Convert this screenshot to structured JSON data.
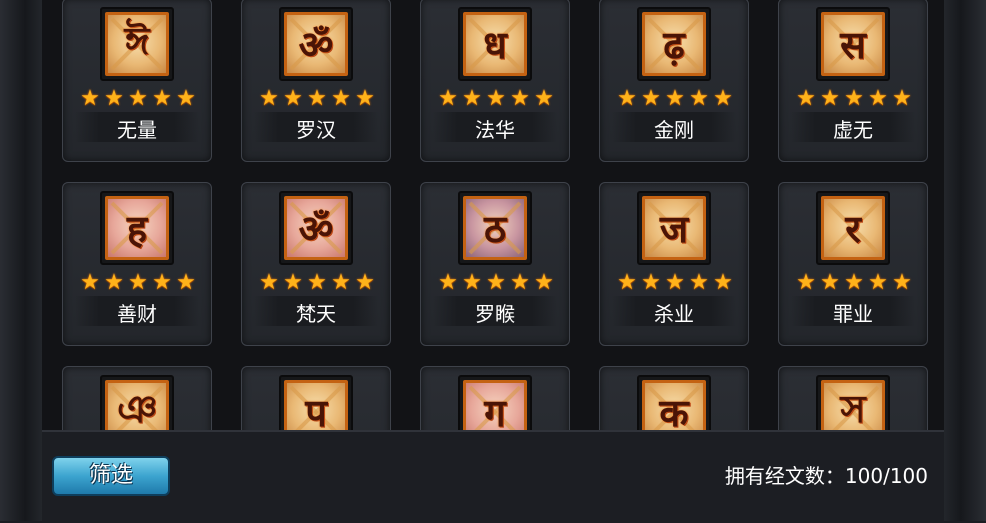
{
  "cards": [
    {
      "name": "无量",
      "stars": 5,
      "glyph": "ঈ",
      "tone": "gold"
    },
    {
      "name": "罗汉",
      "stars": 5,
      "glyph": "ॐ",
      "tone": "gold"
    },
    {
      "name": "法华",
      "stars": 5,
      "glyph": "ध",
      "tone": "gold"
    },
    {
      "name": "金刚",
      "stars": 5,
      "glyph": "ढ़",
      "tone": "gold"
    },
    {
      "name": "虚无",
      "stars": 5,
      "glyph": "स",
      "tone": "gold"
    },
    {
      "name": "善财",
      "stars": 5,
      "glyph": "ह",
      "tone": "pink"
    },
    {
      "name": "梵天",
      "stars": 5,
      "glyph": "ॐ",
      "tone": "pink"
    },
    {
      "name": "罗睺",
      "stars": 5,
      "glyph": "ठ",
      "tone": "mauve"
    },
    {
      "name": "杀业",
      "stars": 5,
      "glyph": "ज",
      "tone": "gold"
    },
    {
      "name": "罪业",
      "stars": 5,
      "glyph": "र",
      "tone": "gold"
    },
    {
      "name": "",
      "stars": 0,
      "glyph": "ঞ",
      "tone": "gold"
    },
    {
      "name": "",
      "stars": 0,
      "glyph": "प",
      "tone": "gold"
    },
    {
      "name": "",
      "stars": 0,
      "glyph": "ग",
      "tone": "pink"
    },
    {
      "name": "",
      "stars": 0,
      "glyph": "क",
      "tone": "gold"
    },
    {
      "name": "",
      "stars": 0,
      "glyph": "স",
      "tone": "gold"
    }
  ],
  "bottom": {
    "filter_label": "筛选",
    "count_label": "拥有经文数：100/100"
  },
  "icons": {
    "star": "star-icon",
    "rune": "sutra-rune-icon"
  },
  "colors": {
    "star": "#ffb21a",
    "icon_border": "#c46212",
    "button": "#3ca4cf"
  }
}
